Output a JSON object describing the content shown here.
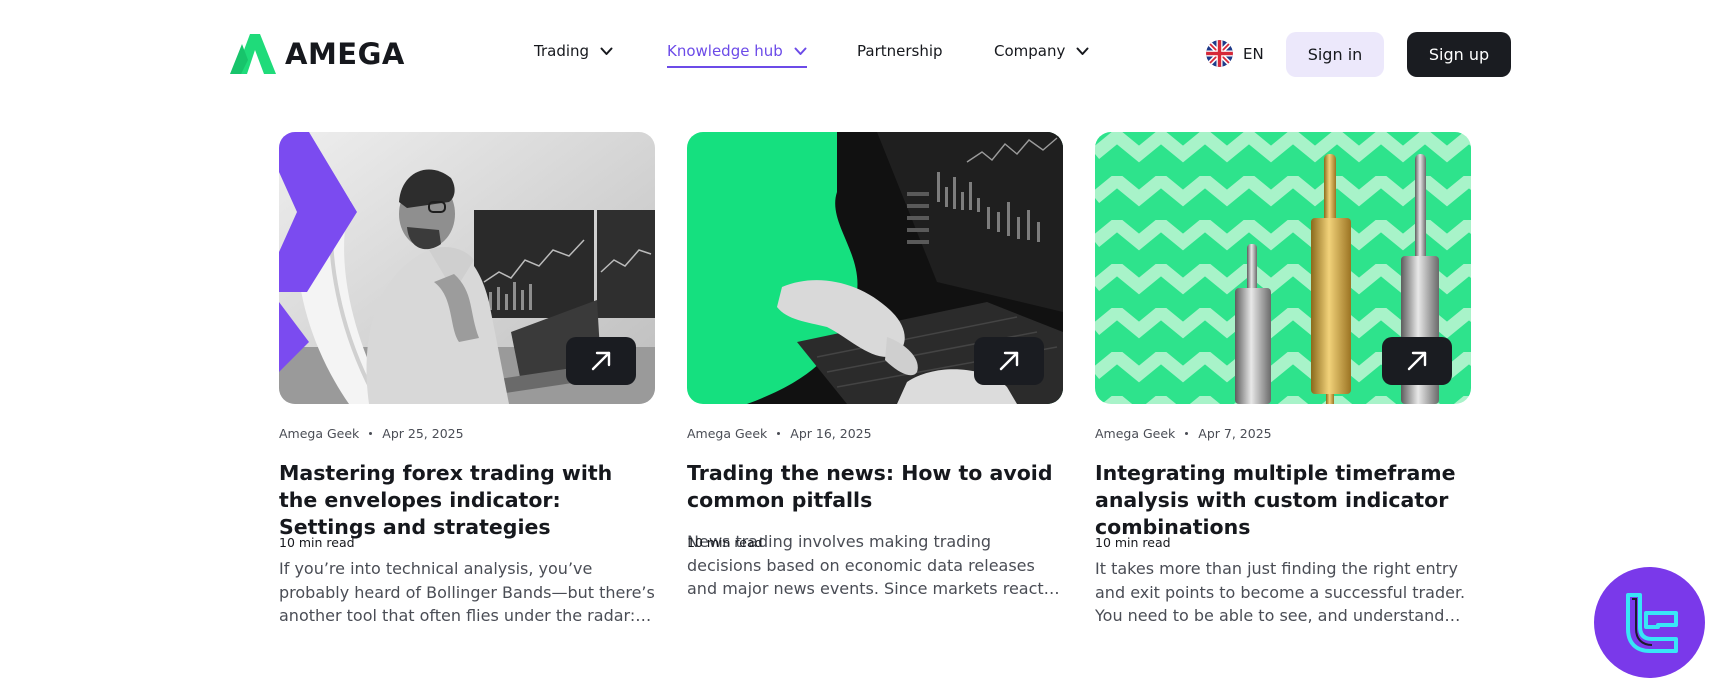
{
  "brand": {
    "name": "AMEGA",
    "accent": "#6c4be8",
    "logo_green": "#1fdb7a"
  },
  "nav": {
    "items": [
      {
        "label": "Trading",
        "has_dropdown": true,
        "active": false
      },
      {
        "label": "Knowledge hub",
        "has_dropdown": true,
        "active": true
      },
      {
        "label": "Partnership",
        "has_dropdown": false,
        "active": false
      },
      {
        "label": "Company",
        "has_dropdown": true,
        "active": false
      }
    ],
    "language": {
      "code": "EN",
      "icon": "uk-flag-icon"
    },
    "sign_in_label": "Sign in",
    "sign_up_label": "Sign up"
  },
  "articles": [
    {
      "author": "Amega Geek",
      "date": "Apr 25, 2025",
      "title": "Mastering forex trading with the envelopes indicator: Settings and strategies",
      "excerpt": "If you’re into technical analysis, you’ve probably heard of Bollinger Bands—but there’s another tool that often flies under the radar: the…",
      "read_time": "10 min read",
      "image": "trader-at-monitors-photo"
    },
    {
      "author": "Amega Geek",
      "date": "Apr 16, 2025",
      "title": "Trading the news: How to avoid common pitfalls",
      "excerpt": "News trading involves making trading decisions based on economic data releases and major news events. Since markets react to new…",
      "read_time": "10 min read",
      "image": "hands-on-laptop-keyboard-photo"
    },
    {
      "author": "Amega Geek",
      "date": "Apr 7, 2025",
      "title": "Integrating multiple timeframe analysis with custom indicator combinations",
      "excerpt": "It takes more than just finding the right entry and exit points to become a successful trader. You need to be able to see, and understand th…",
      "read_time": "10 min read",
      "image": "candlestick-sculptures-on-zigzag-photo"
    }
  ],
  "floating_badge": {
    "icon": "tc-logo-icon",
    "color": "#7a39ea"
  }
}
